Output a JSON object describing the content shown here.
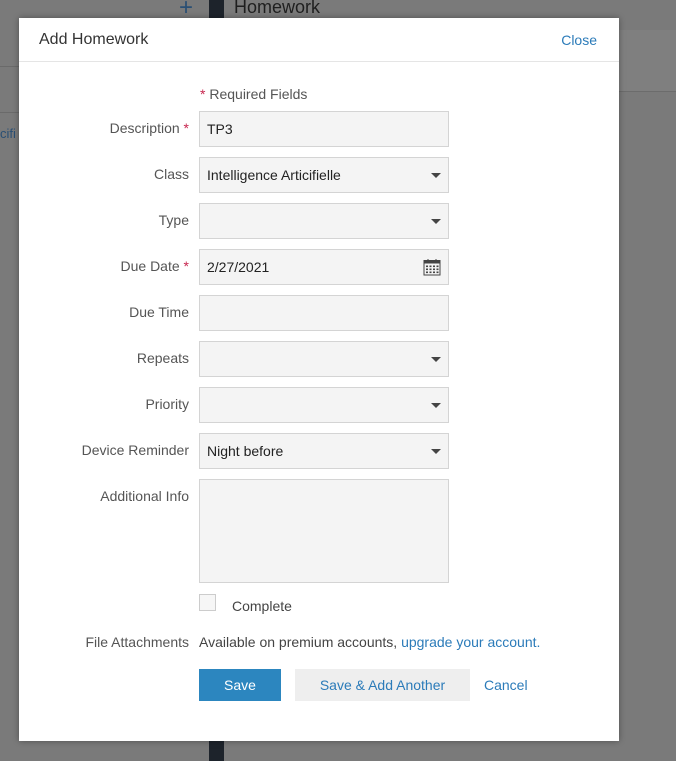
{
  "background": {
    "page_title": "Homework",
    "plus_symbol": "+",
    "side_text": "cifi"
  },
  "modal": {
    "title": "Add Homework",
    "close_label": "Close",
    "required_star": "*",
    "required_note": "Required Fields"
  },
  "form": {
    "description": {
      "label": "Description",
      "value": "TP3",
      "required": true
    },
    "class": {
      "label": "Class",
      "value": "Intelligence Articifielle"
    },
    "type": {
      "label": "Type",
      "value": ""
    },
    "due_date": {
      "label": "Due Date",
      "value": "2/27/2021",
      "required": true
    },
    "due_time": {
      "label": "Due Time",
      "value": ""
    },
    "repeats": {
      "label": "Repeats",
      "value": ""
    },
    "priority": {
      "label": "Priority",
      "value": ""
    },
    "device_reminder": {
      "label": "Device Reminder",
      "value": "Night before"
    },
    "additional_info": {
      "label": "Additional Info",
      "value": ""
    },
    "complete": {
      "label": "Complete",
      "checked": false
    },
    "file_attachments": {
      "label": "File Attachments",
      "text": "Available on premium accounts, ",
      "link": "upgrade your account",
      "suffix": "."
    }
  },
  "actions": {
    "save": "Save",
    "save_add_another": "Save & Add Another",
    "cancel": "Cancel"
  },
  "colors": {
    "accent": "#2c86bf",
    "link": "#2b7bb9",
    "required": "#c7254e",
    "overlay": "#7a7a7a"
  }
}
